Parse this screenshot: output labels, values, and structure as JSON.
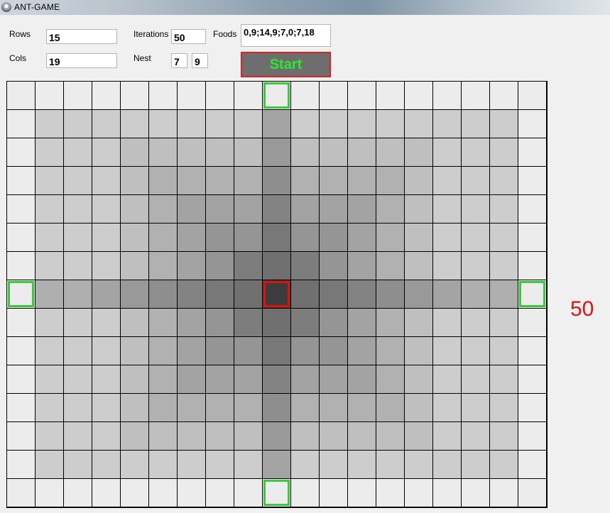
{
  "window": {
    "title": "ANT-GAME"
  },
  "form": {
    "rows_label": "Rows",
    "rows_value": "15",
    "cols_label": "Cols",
    "cols_value": "19",
    "iterations_label": "Iterations",
    "iterations_value": "50",
    "nest_label": "Nest",
    "nest_row": "7",
    "nest_col": "9",
    "foods_label": "Foods",
    "foods_value": "0,9;14,9;7,0;7,18",
    "start_label": "Start"
  },
  "grid": {
    "rows": 15,
    "cols": 19,
    "nest": [
      7,
      9
    ],
    "foods": [
      [
        0,
        9
      ],
      [
        14,
        9
      ],
      [
        7,
        0
      ],
      [
        7,
        18
      ]
    ]
  },
  "counter": "50",
  "colors": {
    "food_border": "#3cc83c",
    "nest_border": "#e01010",
    "start_text": "#2ee82e"
  }
}
